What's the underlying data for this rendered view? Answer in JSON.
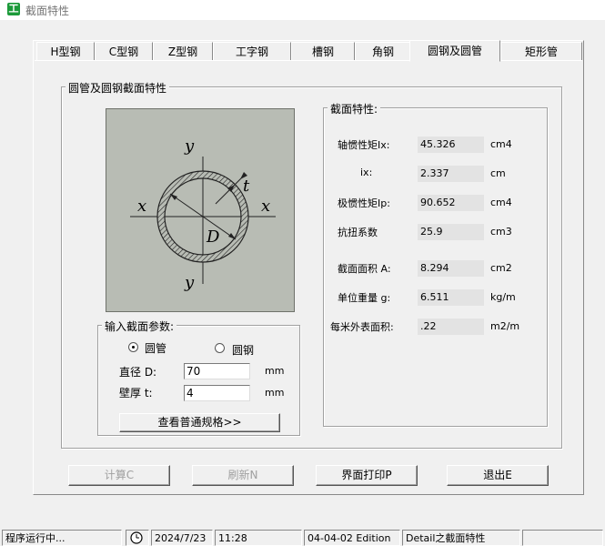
{
  "window": {
    "title": "截面特性"
  },
  "tabs": [
    {
      "label": "H型钢"
    },
    {
      "label": "C型钢"
    },
    {
      "label": "Z型钢"
    },
    {
      "label": "工字钢"
    },
    {
      "label": "槽钢"
    },
    {
      "label": "角钢"
    },
    {
      "label": "圆钢及圆管"
    },
    {
      "label": "矩形管"
    }
  ],
  "active_tab": "圆钢及圆管",
  "section_group": {
    "title": "圆管及圆钢截面特性"
  },
  "diagram": {
    "y_top": "y",
    "y_bottom": "y",
    "x_left": "x",
    "x_right": "x",
    "t": "t",
    "D": "D"
  },
  "input_group": {
    "title": "输入截面参数:",
    "radio_tube": "圆管",
    "radio_bar": "圆钢",
    "selected": "圆管",
    "diameter_label": "直径 D:",
    "diameter_value": "70",
    "diameter_unit": "mm",
    "thickness_label": "壁厚 t:",
    "thickness_value": "4",
    "thickness_unit": "mm",
    "view_spec_button": "查看普通规格>>"
  },
  "properties": {
    "title": "截面特性:",
    "rows": [
      {
        "label": "轴惯性矩Ix:",
        "value": "45.326",
        "unit": "cm4"
      },
      {
        "label": "ix:",
        "value": "2.337",
        "unit": "cm"
      },
      {
        "label": "极惯性矩Ip:",
        "value": "90.652",
        "unit": "cm4"
      },
      {
        "label": "抗扭系数",
        "value": "25.9",
        "unit": "cm3"
      },
      {
        "label": "截面面积 A:",
        "value": "8.294",
        "unit": "cm2"
      },
      {
        "label": "单位重量 g:",
        "value": "6.511",
        "unit": "kg/m"
      },
      {
        "label": "每米外表面积:",
        "value": ".22",
        "unit": "m2/m"
      }
    ]
  },
  "buttons": {
    "calculate": "计算C",
    "refresh": "刷新N",
    "print": "界面打印P",
    "exit": "退出E"
  },
  "status": {
    "state": "程序运行中...",
    "date": "2024/7/23",
    "time": "11:28",
    "edition": "04-04-02 Edition",
    "module": "Detail之截面特性"
  },
  "colors": {
    "diagram_bg": "#b8bcb4",
    "title_icon": "#1c9a3a"
  }
}
